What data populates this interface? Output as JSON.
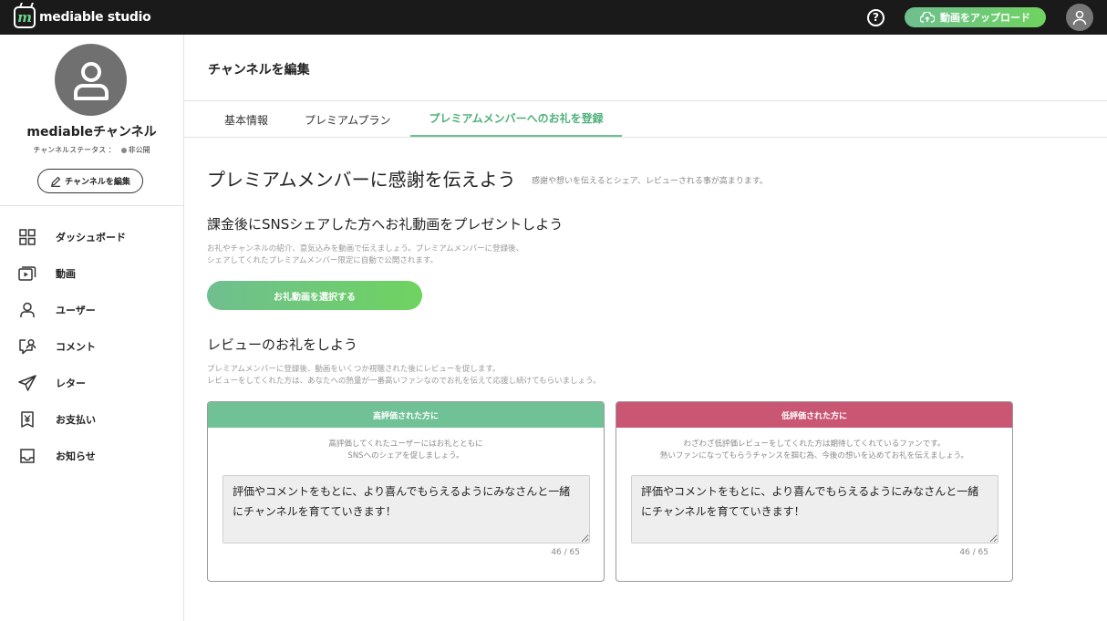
{
  "app": {
    "brand": "mediable studio",
    "logo_glyph": "m"
  },
  "topbar": {
    "help_glyph": "?",
    "upload_label": "動画をアップロード"
  },
  "sidebar": {
    "channel_name": "mediableチャンネル",
    "status_label": "チャンネルステータス",
    "status_sep": "：",
    "status_value": "非公開",
    "edit_label": "チャンネルを編集",
    "items": [
      {
        "label": "ダッシュボード",
        "icon": "grid-icon"
      },
      {
        "label": "動画",
        "icon": "video-icon"
      },
      {
        "label": "ユーザー",
        "icon": "user-icon"
      },
      {
        "label": "コメント",
        "icon": "comment-icon"
      },
      {
        "label": "レター",
        "icon": "send-icon"
      },
      {
        "label": "お支払い",
        "icon": "yen-icon"
      },
      {
        "label": "お知らせ",
        "icon": "notice-icon"
      }
    ]
  },
  "main": {
    "page_title": "チャンネルを編集",
    "tabs": [
      {
        "label": "基本情報"
      },
      {
        "label": "プレミアムプラン"
      },
      {
        "label": "プレミアムメンバーへのお礼を登録"
      }
    ],
    "hero_title": "プレミアムメンバーに感謝を伝えよう",
    "hero_sub": "感謝や想いを伝えるとシェア、レビューされる事が高まります。",
    "sns": {
      "title": "課金後にSNSシェアした方へお礼動画をプレゼントしよう",
      "desc1": "お礼やチャンネルの紹介、意気込みを動画で伝えましょう。プレミアムメンバーに登録後、",
      "desc2": "シェアしてくれたプレミアムメンバー限定に自動で公開されます。",
      "button": "お礼動画を選択する"
    },
    "review": {
      "title": "レビューのお礼をしよう",
      "desc1": "プレミアムメンバーに登録後、動画をいくつか視聴された後にレビューを促します。",
      "desc2": "レビューをしてくれた方は、あなたへの熱量が一番高いファンなのでお礼を伝えて応援し続けてもらいましょう。"
    },
    "cards": {
      "high": {
        "header": "高評価された方に",
        "desc1": "高評価してくれたユーザーにはお礼とともに",
        "desc2": "SNSへのシェアを促しましょう。",
        "text": "評価やコメントをもとに、より喜んでもらえるようにみなさんと一緒にチャンネルを育てていきます！",
        "count": "46 / 65"
      },
      "low": {
        "header": "低評価された方に",
        "desc1": "わざわざ低評価レビューをしてくれた方は期待してくれているファンです。",
        "desc2": "熱いファンになってもらうチャンスを掴む為、今後の想いを込めてお礼を伝えましょう。",
        "text": "評価やコメントをもとに、より喜んでもらえるようにみなさんと一緒にチャンネルを育てていきます！",
        "count": "46 / 65"
      }
    }
  },
  "colors": {
    "accent_green": "#6cc08d",
    "high_header": "#70c195",
    "low_header": "#c95673",
    "topbar_bg": "#1a1a1a"
  }
}
